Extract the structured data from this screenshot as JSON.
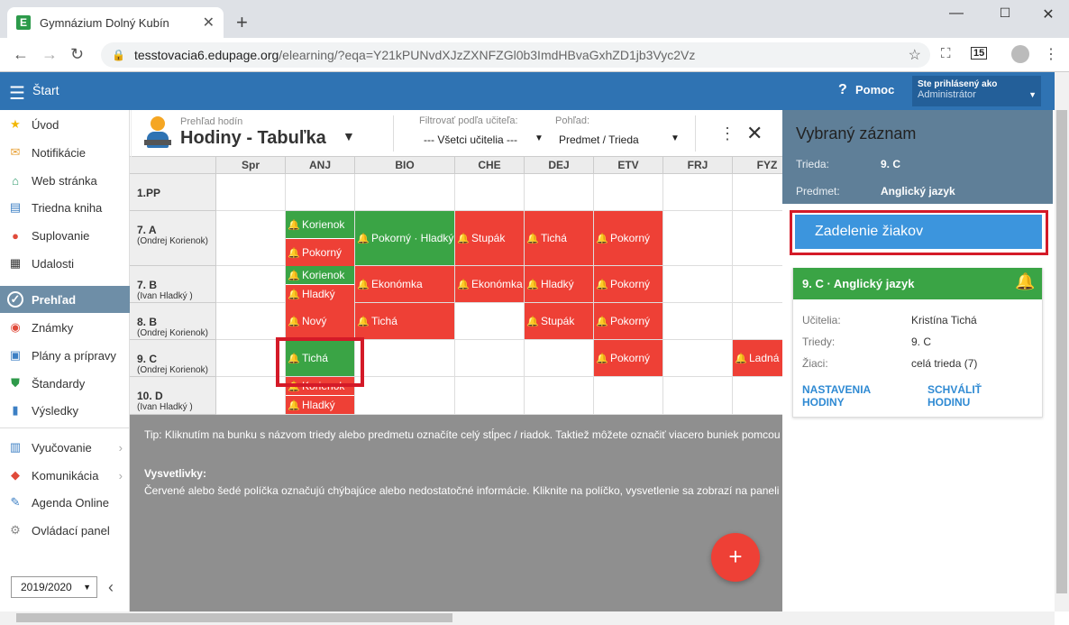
{
  "browser": {
    "tab_title": "Gymnázium Dolný Kubín",
    "url_host": "tesstovacia6.edupage.org",
    "url_path": "/elearning/?eqa=Y21kPUNvdXJzZXNFZGl0b3ImdHBvaGxhZD1jb3Vyc2Vz",
    "profile_badge": "15"
  },
  "header": {
    "start": "Štart",
    "help": "Pomoc",
    "logged_in_as": "Ste prihlásený ako",
    "user": "Administrátor"
  },
  "sidebar": {
    "items": [
      {
        "label": "Úvod",
        "icon": "star-icon",
        "color": "#f2b705"
      },
      {
        "label": "Notifikácie",
        "icon": "envelope-icon",
        "color": "#e8a23a"
      },
      {
        "label": "Web stránka",
        "icon": "home-icon",
        "color": "#2e9a6b"
      },
      {
        "label": "Triedna kniha",
        "icon": "book-icon",
        "color": "#3c7fc4"
      },
      {
        "label": "Suplovanie",
        "icon": "person-icon",
        "color": "#e04a3a"
      },
      {
        "label": "Udalosti",
        "icon": "calendar-icon",
        "color": "#333333"
      },
      {
        "label": "Prehľad",
        "icon": "check-icon",
        "color": "#ffffff"
      },
      {
        "label": "Známky",
        "icon": "grades-icon",
        "color": "#e04a3a"
      },
      {
        "label": "Plány a prípravy",
        "icon": "briefcase-icon",
        "color": "#3c7fc4"
      },
      {
        "label": "Štandardy",
        "icon": "shield-icon",
        "color": "#2e9a4a"
      },
      {
        "label": "Výsledky",
        "icon": "bar-chart-icon",
        "color": "#3c7fc4"
      },
      {
        "label": "Vyučovanie",
        "icon": "open-book-icon",
        "color": "#3c7fc4"
      },
      {
        "label": "Komunikácia",
        "icon": "chat-icon",
        "color": "#e04a3a"
      },
      {
        "label": "Agenda Online",
        "icon": "pen-icon",
        "color": "#3c7fc4"
      },
      {
        "label": "Ovládací panel",
        "icon": "gear-icon",
        "color": "#888888"
      }
    ],
    "year": "2019/2020"
  },
  "toolbar": {
    "breadcrumb": "Prehľad hodín",
    "title": "Hodiny - Tabuľka",
    "filter_label": "Filtrovať podľa učiteľa:",
    "filter_value": "--- Všetci učitelia ---",
    "view_label": "Pohľad:",
    "view_value": "Predmet / Trieda"
  },
  "table": {
    "columns": [
      "Spr",
      "ANJ",
      "BIO",
      "CHE",
      "DEJ",
      "ETV",
      "FRJ",
      "FYZ"
    ],
    "rows": [
      {
        "name": "1.PP",
        "teacher": ""
      },
      {
        "name": "7. A",
        "teacher": "(Ondrej Korienok)"
      },
      {
        "name": "7. B",
        "teacher": "(Ivan Hladký )"
      },
      {
        "name": "8. B",
        "teacher": "(Ondrej Korienok)"
      },
      {
        "name": "9. C",
        "teacher": "(Ondrej Korienok)"
      },
      {
        "name": "10. D",
        "teacher": "(Ivan Hladký )"
      }
    ],
    "lessons": [
      {
        "row": 1,
        "col": 1,
        "part": 0,
        "parts": 2,
        "text": "Korienok",
        "color": "green"
      },
      {
        "row": 1,
        "col": 1,
        "part": 1,
        "parts": 2,
        "text": "Pokorný",
        "color": "red"
      },
      {
        "row": 1,
        "col": 2,
        "part": 0,
        "parts": 1,
        "text": "Pokorný · Hladký",
        "color": "green"
      },
      {
        "row": 1,
        "col": 3,
        "part": 0,
        "parts": 1,
        "text": "Stupák",
        "color": "red"
      },
      {
        "row": 1,
        "col": 4,
        "part": 0,
        "parts": 1,
        "text": "Tichá",
        "color": "red"
      },
      {
        "row": 1,
        "col": 5,
        "part": 0,
        "parts": 1,
        "text": "Pokorný",
        "color": "red"
      },
      {
        "row": 2,
        "col": 1,
        "part": 0,
        "parts": 2,
        "text": "Korienok",
        "color": "green"
      },
      {
        "row": 2,
        "col": 1,
        "part": 1,
        "parts": 2,
        "text": "Hladký",
        "color": "red"
      },
      {
        "row": 2,
        "col": 2,
        "part": 0,
        "parts": 1,
        "text": "Ekonómka",
        "color": "red"
      },
      {
        "row": 2,
        "col": 3,
        "part": 0,
        "parts": 1,
        "text": "Ekonómka",
        "color": "red"
      },
      {
        "row": 2,
        "col": 4,
        "part": 0,
        "parts": 1,
        "text": "Hladký",
        "color": "red"
      },
      {
        "row": 2,
        "col": 5,
        "part": 0,
        "parts": 1,
        "text": "Pokorný",
        "color": "red"
      },
      {
        "row": 3,
        "col": 1,
        "part": 0,
        "parts": 1,
        "text": "Nový",
        "color": "red"
      },
      {
        "row": 3,
        "col": 2,
        "part": 0,
        "parts": 1,
        "text": "Tichá",
        "color": "red"
      },
      {
        "row": 3,
        "col": 4,
        "part": 0,
        "parts": 1,
        "text": "Stupák",
        "color": "red"
      },
      {
        "row": 3,
        "col": 5,
        "part": 0,
        "parts": 1,
        "text": "Pokorný",
        "color": "red"
      },
      {
        "row": 4,
        "col": 1,
        "part": 0,
        "parts": 1,
        "text": "Tichá",
        "color": "green"
      },
      {
        "row": 4,
        "col": 5,
        "part": 0,
        "parts": 1,
        "text": "Pokorný",
        "color": "red"
      },
      {
        "row": 4,
        "col": 7,
        "part": 0,
        "parts": 1,
        "text": "Ladná",
        "color": "red"
      },
      {
        "row": 5,
        "col": 1,
        "part": 0,
        "parts": 2,
        "text": "Korienok",
        "color": "red"
      },
      {
        "row": 5,
        "col": 1,
        "part": 1,
        "parts": 2,
        "text": "Hladký",
        "color": "red"
      }
    ]
  },
  "tip": "Tip: Kliknutím na bunku s názvom triedy alebo predmetu označíte celý stĺpec / riadok. Taktiež môžete označiť viacero buniek pomcou",
  "legend": {
    "title": "Vysvetlivky:",
    "text": "Červené alebo šedé políčka označujú chýbajúce alebo nedostatočné informácie. Kliknite na políčko, vysvetlenie sa zobrazí na paneli"
  },
  "fab": "+",
  "panel": {
    "title": "Vybraný záznam",
    "class_label": "Trieda:",
    "class_value": "9. C",
    "subject_label": "Predmet:",
    "subject_value": "Anglický jazyk",
    "assign_button": "Zadelenie žiakov",
    "card": {
      "title": "9. C · Anglický jazyk",
      "teachers_label": "Učitelia:",
      "teachers_value": "Kristína Tichá",
      "classes_label": "Triedy:",
      "classes_value": "9. C",
      "students_label": "Žiaci:",
      "students_value": "celá trieda (7)",
      "link1": "NASTAVENIA HODINY",
      "link2": "SCHVÁLIŤ HODINU"
    }
  },
  "colors": {
    "accent": "#2f73b3",
    "red": "#ee4036",
    "green": "#3aa445",
    "panel": "#5f7f98"
  }
}
